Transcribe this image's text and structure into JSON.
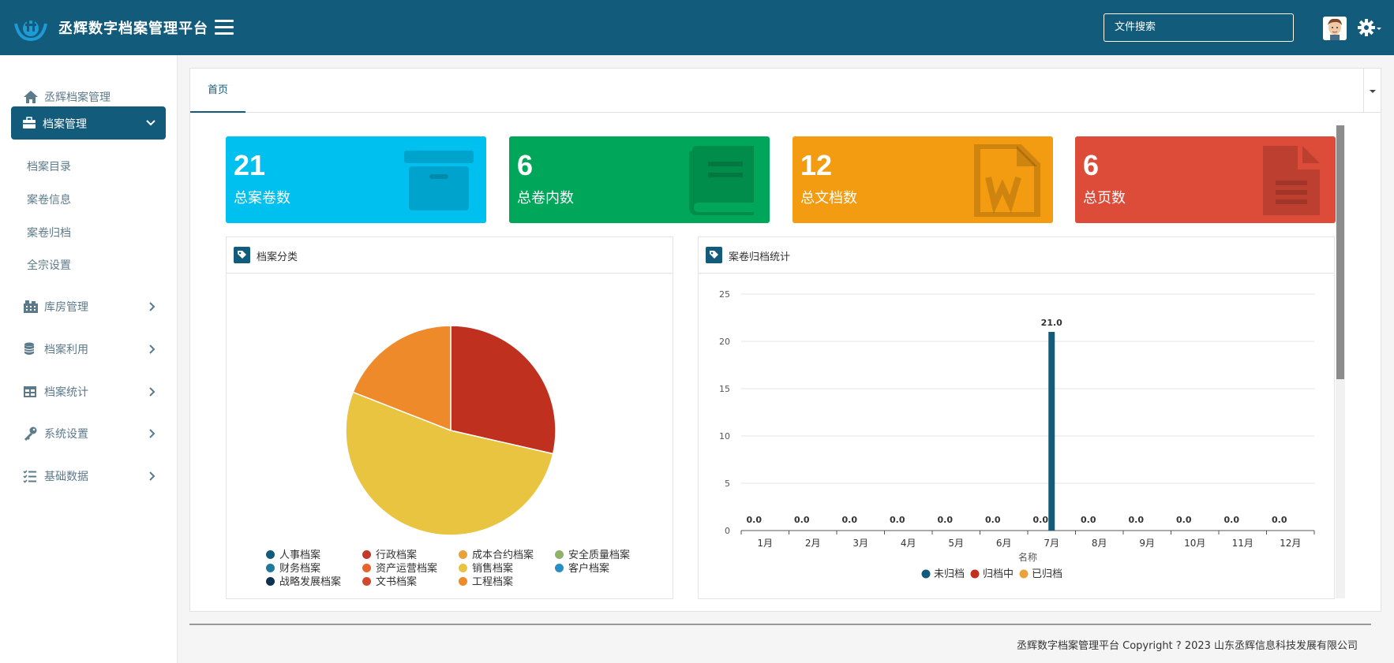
{
  "header": {
    "brand": "丞辉数字档案管理平台",
    "search_placeholder": "文件搜索",
    "accent": "#135b7a"
  },
  "sidebar": {
    "top_item": "丞辉档案管理",
    "active_group": "档案管理",
    "sub_items": [
      "档案目录",
      "案卷信息",
      "案卷归档",
      "全宗设置"
    ],
    "groups": [
      "库房管理",
      "档案利用",
      "档案统计",
      "系统设置",
      "基础数据"
    ]
  },
  "tabs": {
    "home": "首页"
  },
  "cards": [
    {
      "value": "21",
      "label": "总案卷数",
      "color": "#00c0ef",
      "icon": "archive-box-icon"
    },
    {
      "value": "6",
      "label": "总卷内数",
      "color": "#00a65a",
      "icon": "book-icon"
    },
    {
      "value": "12",
      "label": "总文档数",
      "color": "#f39c12",
      "icon": "word-file-icon"
    },
    {
      "value": "6",
      "label": "总页数",
      "color": "#dd4b39",
      "icon": "document-icon"
    }
  ],
  "pie_panel": {
    "title": "档案分类"
  },
  "bar_panel": {
    "title": "案卷归档统计"
  },
  "chart_data": [
    {
      "type": "pie",
      "title": "档案分类",
      "categories": [
        "人事档案",
        "行政档案",
        "成本合约档案",
        "安全质量档案",
        "财务档案",
        "资产运营档案",
        "销售档案",
        "客户档案",
        "战略发展档案",
        "文书档案",
        "工程档案"
      ],
      "legend_colors": [
        "#135b7a",
        "#c0392b",
        "#e9a13b",
        "#8fb16a",
        "#1f7a9a",
        "#e8632b",
        "#e8c441",
        "#2a8ec4",
        "#0e3350",
        "#d4472d",
        "#ee8a2a"
      ],
      "slices": [
        {
          "name": "行政档案",
          "value": 6,
          "color": "#c0301f"
        },
        {
          "name": "销售档案",
          "value": 11,
          "color": "#e8c441"
        },
        {
          "name": "工程档案",
          "value": 4,
          "color": "#ee8a2a"
        }
      ],
      "legend_position": "bottom"
    },
    {
      "type": "bar",
      "title": "案卷归档统计",
      "xlabel": "名称",
      "ylabel": "",
      "categories": [
        "1月",
        "2月",
        "3月",
        "4月",
        "5月",
        "6月",
        "7月",
        "8月",
        "9月",
        "10月",
        "11月",
        "12月"
      ],
      "series": [
        {
          "name": "未归档",
          "color": "#135b7a",
          "values": [
            0,
            0,
            0,
            0,
            0,
            0,
            21,
            0,
            0,
            0,
            0,
            0
          ]
        },
        {
          "name": "归档中",
          "color": "#c0301f",
          "values": [
            0,
            0,
            0,
            0,
            0,
            0,
            0,
            0,
            0,
            0,
            0,
            0
          ]
        },
        {
          "name": "已归档",
          "color": "#e9a13b",
          "values": [
            0,
            0,
            0,
            0,
            0,
            0,
            0,
            0,
            0,
            0,
            0,
            0
          ]
        }
      ],
      "data_labels": [
        "0.0",
        "0.0",
        "0.0",
        "0.0",
        "0.0",
        "0.0",
        "0.0",
        "0.0",
        "0.0",
        "0.0",
        "0.0",
        "0.0"
      ],
      "peak_label": "21.0",
      "yticks": [
        "0",
        "5",
        "10",
        "15",
        "20",
        "25"
      ],
      "ylim": [
        0,
        25
      ],
      "grid": true,
      "legend_position": "bottom"
    }
  ],
  "footer": {
    "text": "丞辉数字档案管理平台 Copyright ? 2023 山东丞辉信息科技发展有限公司"
  }
}
